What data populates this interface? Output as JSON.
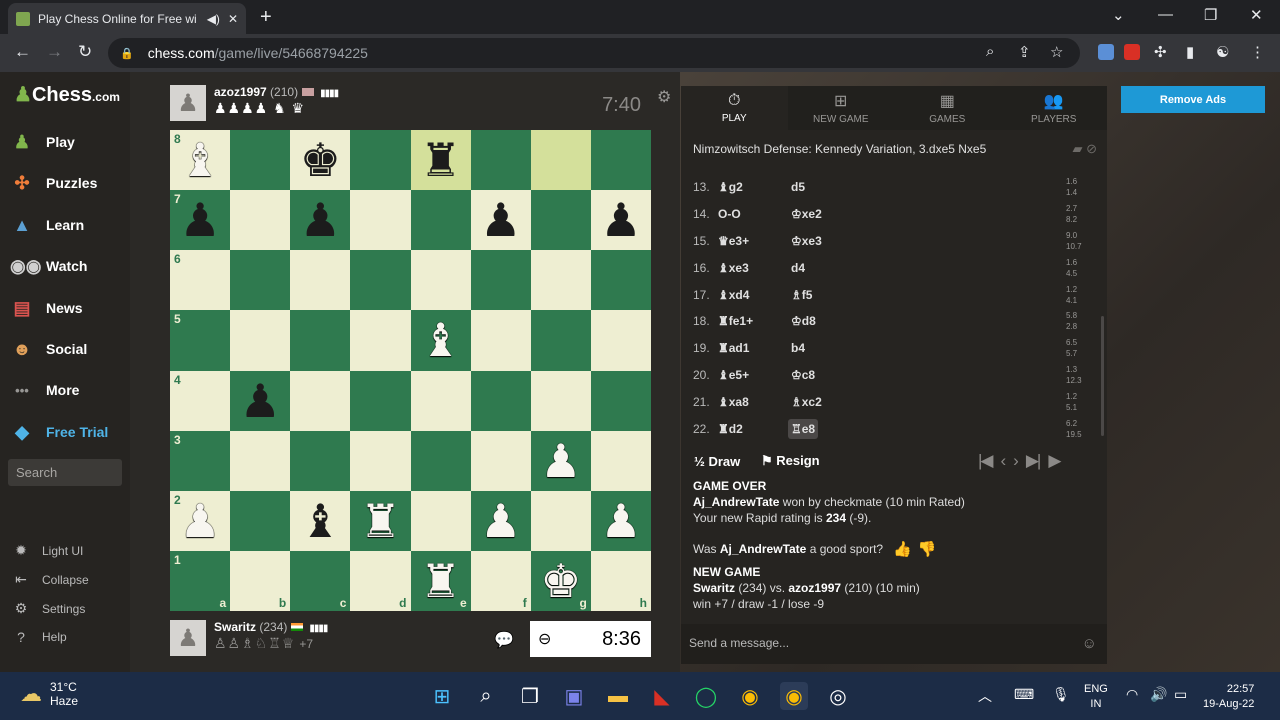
{
  "browser": {
    "tab_title": "Play Chess Online for Free wi",
    "url_host": "chess.com",
    "url_path": "/game/live/54668794225",
    "new_tab": "+",
    "minimize": "⌄",
    "restore": "—",
    "maximize": "❐",
    "close": "✕"
  },
  "sidebar": {
    "logo_text": "Chess",
    "logo_suffix": ".com",
    "items": [
      {
        "label": "Play",
        "icon": "play-icon"
      },
      {
        "label": "Puzzles",
        "icon": "puzzle-icon"
      },
      {
        "label": "Learn",
        "icon": "learn-icon"
      },
      {
        "label": "Watch",
        "icon": "watch-icon"
      },
      {
        "label": "News",
        "icon": "news-icon"
      },
      {
        "label": "Social",
        "icon": "social-icon"
      },
      {
        "label": "More",
        "icon": "more-icon"
      },
      {
        "label": "Free Trial",
        "icon": "diamond-icon"
      }
    ],
    "search_placeholder": "Search",
    "bottom": [
      {
        "label": "Light UI",
        "icon": "sun-icon"
      },
      {
        "label": "Collapse",
        "icon": "collapse-icon"
      },
      {
        "label": "Settings",
        "icon": "gear-icon"
      },
      {
        "label": "Help",
        "icon": "help-icon"
      }
    ]
  },
  "opponent": {
    "name": "azoz1997",
    "rating": "(210)",
    "captured": "♟♟♟♟ ♞ ♛",
    "clock": "7:40"
  },
  "player": {
    "name": "Swaritz",
    "rating": "(234)",
    "captured": "♙♙♗♘♖♕",
    "advantage": "+7",
    "clock": "8:36"
  },
  "board": {
    "files": [
      "a",
      "b",
      "c",
      "d",
      "e",
      "f",
      "g",
      "h"
    ],
    "ranks": [
      "8",
      "7",
      "6",
      "5",
      "4",
      "3",
      "2",
      "1"
    ],
    "highlight": [
      "e8",
      "g8"
    ],
    "pieces": {
      "a8": "wB",
      "c8": "bK",
      "e8": "bR",
      "a7": "bP",
      "c7": "bP",
      "f7": "bP",
      "h7": "bP",
      "e5": "wB",
      "b4": "bP",
      "g3": "wP",
      "a2": "wP",
      "c2": "bB",
      "d2": "wR",
      "f2": "wP",
      "h2": "wP",
      "e1": "wR",
      "g1": "wK"
    }
  },
  "panel": {
    "tabs": [
      {
        "label": "PLAY",
        "icon": "stopwatch-icon"
      },
      {
        "label": "NEW GAME",
        "icon": "plus-icon"
      },
      {
        "label": "GAMES",
        "icon": "games-icon"
      },
      {
        "label": "PLAYERS",
        "icon": "players-icon"
      }
    ],
    "opening": "Nimzowitsch Defense: Kennedy Variation, 3.dxe5 Nxe5",
    "moves": [
      {
        "n": "13.",
        "w": "♝g2",
        "b": "d5",
        "ev1": "1.6",
        "ev2": "1.4"
      },
      {
        "n": "14.",
        "w": "O-O",
        "b": "♔xe2",
        "ev1": "2.7",
        "ev2": "8.2"
      },
      {
        "n": "15.",
        "w": "♛e3+",
        "b": "♔xe3",
        "ev1": "9.0",
        "ev2": "10.7"
      },
      {
        "n": "16.",
        "w": "♝xe3",
        "b": "d4",
        "ev1": "1.6",
        "ev2": "4.5"
      },
      {
        "n": "17.",
        "w": "♝xd4",
        "b": "♗f5",
        "ev1": "1.2",
        "ev2": "4.1"
      },
      {
        "n": "18.",
        "w": "♜fe1+",
        "b": "♔d8",
        "ev1": "5.8",
        "ev2": "2.8"
      },
      {
        "n": "19.",
        "w": "♜ad1",
        "b": "b4",
        "ev1": "6.5",
        "ev2": "5.7"
      },
      {
        "n": "20.",
        "w": "♝e5+",
        "b": "♔c8",
        "ev1": "1.3",
        "ev2": "12.3"
      },
      {
        "n": "21.",
        "w": "♝xa8",
        "b": "♗xc2",
        "ev1": "1.2",
        "ev2": "5.1"
      },
      {
        "n": "22.",
        "w": "♜d2",
        "b": "♖e8",
        "ev1": "6.2",
        "ev2": "19.5"
      }
    ],
    "draw_label": "Draw",
    "draw_icon": "½",
    "resign_label": "Resign",
    "game_over": {
      "title": "GAME OVER",
      "winner": "Aj_AndrewTate",
      "result": " won by checkmate (10 min Rated)",
      "rating_prefix": "Your new Rapid rating is ",
      "rating_value": "234",
      "rating_change": " (-9)."
    },
    "sport": {
      "prefix": "Was ",
      "name": "Aj_AndrewTate",
      "suffix": " a good sport?"
    },
    "new_game": {
      "title": "NEW GAME",
      "p1": "Swaritz",
      "p1_rating": " (234) vs. ",
      "p2": "azoz1997",
      "p2_rating": " (210) (10 min)",
      "stakes": "win +7 / draw -1 / lose -9"
    },
    "send_placeholder": "Send a message..."
  },
  "remove_ads": "Remove Ads",
  "taskbar": {
    "temp": "31°C",
    "condition": "Haze",
    "lang1": "ENG",
    "lang2": "IN",
    "time": "22:57",
    "date": "19-Aug-22"
  }
}
